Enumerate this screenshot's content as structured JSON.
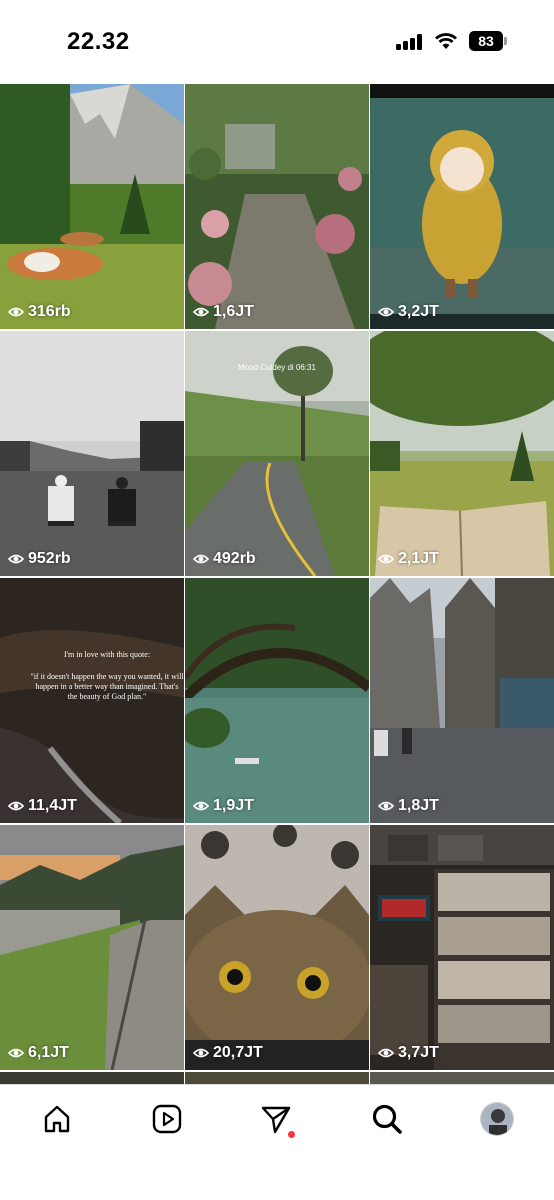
{
  "status_bar": {
    "time": "22.32",
    "battery": "83"
  },
  "grid": [
    {
      "views": "316rb",
      "scene": "mountain-cows"
    },
    {
      "views": "1,6JT",
      "scene": "garden-path"
    },
    {
      "views": "3,2JT",
      "scene": "rain-raincoat"
    },
    {
      "views": "952rb",
      "scene": "bw-couple"
    },
    {
      "views": "492rb",
      "scene": "country-road",
      "caption": "Mood Cuidey di 06:31"
    },
    {
      "views": "2,1JT",
      "scene": "book-field"
    },
    {
      "views": "11,4JT",
      "scene": "ocean-quote",
      "quote_intro": "I'm in love with this quote:",
      "quote_body": "\"if it doesn't happen the way you wanted, it will happen in a better way than imagined. That's the beauty of God plan.\""
    },
    {
      "views": "1,9JT",
      "scene": "lake-tree"
    },
    {
      "views": "1,8JT",
      "scene": "old-street"
    },
    {
      "views": "6,1JT",
      "scene": "alpine-village"
    },
    {
      "views": "20,7JT",
      "scene": "cat-face"
    },
    {
      "views": "3,7JT",
      "scene": "record-shelf"
    }
  ],
  "bottom_nav": {
    "items": [
      "home-icon",
      "reels-icon",
      "send-icon",
      "search-icon",
      "profile-avatar"
    ],
    "notification_color": "#ff3040"
  }
}
